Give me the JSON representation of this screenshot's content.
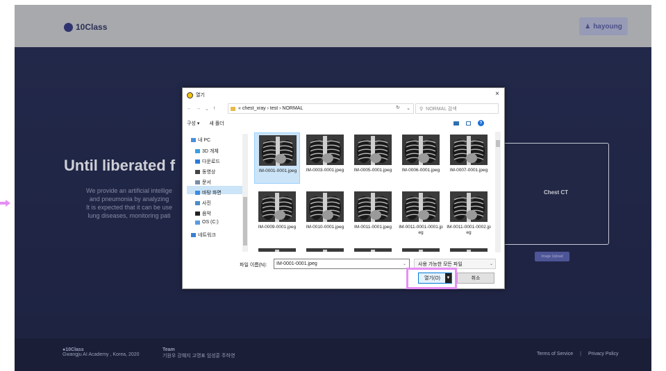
{
  "app": {
    "brand": "10Class",
    "user_button": "hayoung",
    "hero_title": "Until liberated f",
    "hero_lines": [
      "We provide an artificial intellige",
      "and pneumonia by analyzing",
      "It is expected that it can be use",
      "lung diseases, monitoring pati"
    ],
    "panel_label": "Chest CT",
    "upload_button": "Image Upload"
  },
  "footer": {
    "brand": "10Class",
    "address": "Gwangju AI Academy , Korea, 2020",
    "team_title": "Team",
    "team_members": "기원우  강혜지  고명표  임성훈  주하영",
    "terms": "Terms of Service",
    "separator": "|",
    "privacy": "Privacy Policy"
  },
  "dialog": {
    "title": "열기",
    "close": "×",
    "breadcrumb": "« chest_xray  ›  test  ›  NORMAL",
    "search_placeholder": "NORMAL 검색",
    "organize": "구성 ▾",
    "new_folder": "새 폴더",
    "tree": [
      {
        "label": "내 PC",
        "icon": "pc-icon",
        "color": "#4a90d9"
      },
      {
        "label": "3D 개체",
        "icon": "cube-icon",
        "color": "#3aa0e0"
      },
      {
        "label": "다운로드",
        "icon": "download-icon",
        "color": "#2a7bd8"
      },
      {
        "label": "동영상",
        "icon": "video-icon",
        "color": "#444"
      },
      {
        "label": "문서",
        "icon": "document-icon",
        "color": "#7a8da6"
      },
      {
        "label": "바탕 화면",
        "icon": "desktop-icon",
        "color": "#3a8de0"
      },
      {
        "label": "사진",
        "icon": "picture-icon",
        "color": "#4a8ec8"
      },
      {
        "label": "음악",
        "icon": "music-icon",
        "color": "#222"
      },
      {
        "label": "OS (C:)",
        "icon": "drive-icon",
        "color": "#5a9be0"
      },
      {
        "label": "네트워크",
        "icon": "network-icon",
        "color": "#3a7fd0"
      }
    ],
    "files": [
      "IM-0001-0001.jpeg",
      "IM-0003-0001.jpeg",
      "IM-0005-0001.jpeg",
      "IM-0006-0001.jpeg",
      "IM-0007-0001.jpeg",
      "IM-0009-0001.jpeg",
      "IM-0010-0001.jpeg",
      "IM-0011-0001.jpeg",
      "IM-0011-0001-0001.jpeg",
      "IM-0011-0001-0002.jpeg"
    ],
    "filename_label": "파일 이름(N):",
    "filename_value": "IM-0001-0001.jpeg",
    "filetype": "사용 가능한 모든 파일",
    "open_button": "열기(O)",
    "cancel_button": "취소"
  },
  "colors": {
    "accent_highlight": "#e58ef5",
    "selection": "#cce4f7"
  }
}
